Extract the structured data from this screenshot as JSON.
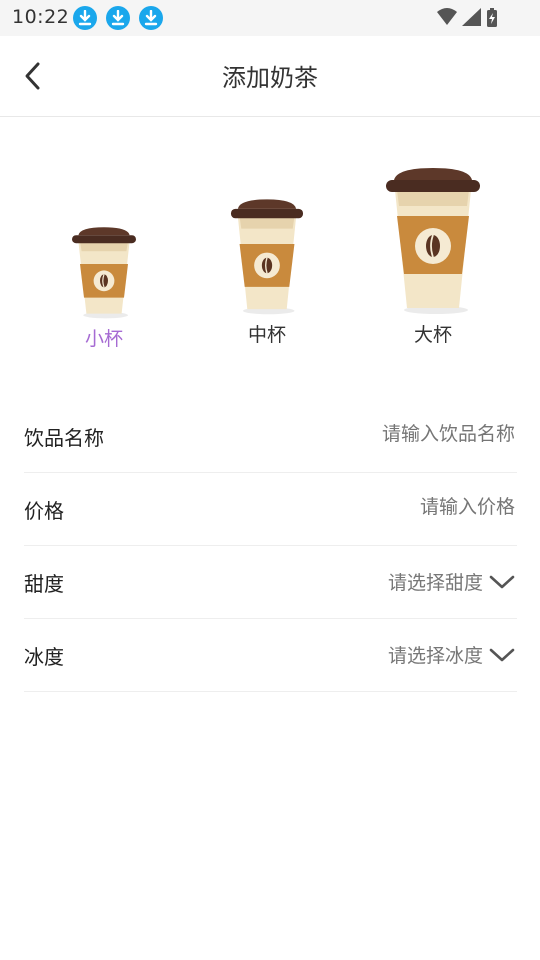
{
  "status_bar": {
    "time": "10:22"
  },
  "header": {
    "title": "添加奶茶"
  },
  "sizes": [
    {
      "label": "小杯",
      "selected": true
    },
    {
      "label": "中杯",
      "selected": false
    },
    {
      "label": "大杯",
      "selected": false
    }
  ],
  "form": {
    "name": {
      "label": "饮品名称",
      "placeholder": "请输入饮品名称"
    },
    "price": {
      "label": "价格",
      "placeholder": "请输入价格"
    },
    "sweetness": {
      "label": "甜度",
      "value": "请选择甜度"
    },
    "ice": {
      "label": "冰度",
      "value": "请选择冰度"
    }
  },
  "colors": {
    "accent": "#a66bd3",
    "status_icon": "#1aa7ec"
  }
}
